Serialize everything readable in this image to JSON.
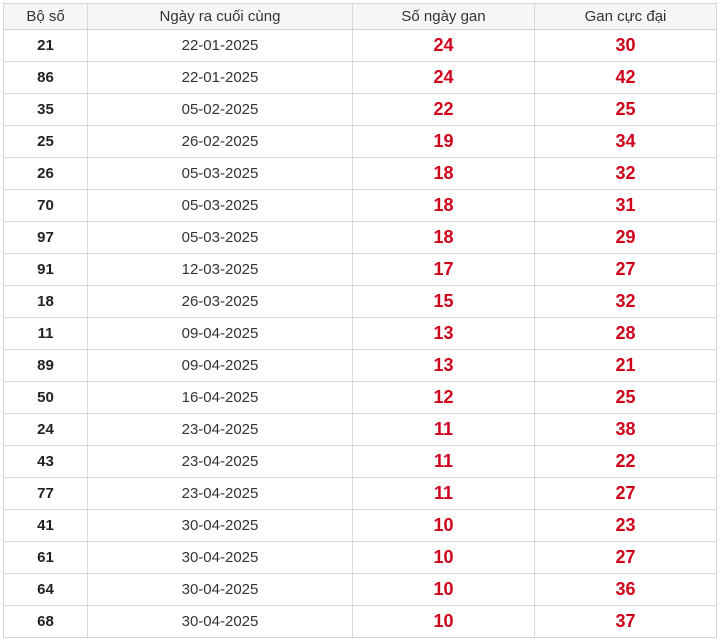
{
  "table": {
    "headers": [
      "Bộ số",
      "Ngày ra cuối cùng",
      "Số ngày gan",
      "Gan cực đại"
    ],
    "rows": [
      {
        "bo_so": "21",
        "ngay": "22-01-2025",
        "so_ngay_gan": "24",
        "gan_cuc_dai": "30"
      },
      {
        "bo_so": "86",
        "ngay": "22-01-2025",
        "so_ngay_gan": "24",
        "gan_cuc_dai": "42"
      },
      {
        "bo_so": "35",
        "ngay": "05-02-2025",
        "so_ngay_gan": "22",
        "gan_cuc_dai": "25"
      },
      {
        "bo_so": "25",
        "ngay": "26-02-2025",
        "so_ngay_gan": "19",
        "gan_cuc_dai": "34"
      },
      {
        "bo_so": "26",
        "ngay": "05-03-2025",
        "so_ngay_gan": "18",
        "gan_cuc_dai": "32"
      },
      {
        "bo_so": "70",
        "ngay": "05-03-2025",
        "so_ngay_gan": "18",
        "gan_cuc_dai": "31"
      },
      {
        "bo_so": "97",
        "ngay": "05-03-2025",
        "so_ngay_gan": "18",
        "gan_cuc_dai": "29"
      },
      {
        "bo_so": "91",
        "ngay": "12-03-2025",
        "so_ngay_gan": "17",
        "gan_cuc_dai": "27"
      },
      {
        "bo_so": "18",
        "ngay": "26-03-2025",
        "so_ngay_gan": "15",
        "gan_cuc_dai": "32"
      },
      {
        "bo_so": "11",
        "ngay": "09-04-2025",
        "so_ngay_gan": "13",
        "gan_cuc_dai": "28"
      },
      {
        "bo_so": "89",
        "ngay": "09-04-2025",
        "so_ngay_gan": "13",
        "gan_cuc_dai": "21"
      },
      {
        "bo_so": "50",
        "ngay": "16-04-2025",
        "so_ngay_gan": "12",
        "gan_cuc_dai": "25"
      },
      {
        "bo_so": "24",
        "ngay": "23-04-2025",
        "so_ngay_gan": "11",
        "gan_cuc_dai": "38"
      },
      {
        "bo_so": "43",
        "ngay": "23-04-2025",
        "so_ngay_gan": "11",
        "gan_cuc_dai": "22"
      },
      {
        "bo_so": "77",
        "ngay": "23-04-2025",
        "so_ngay_gan": "11",
        "gan_cuc_dai": "27"
      },
      {
        "bo_so": "41",
        "ngay": "30-04-2025",
        "so_ngay_gan": "10",
        "gan_cuc_dai": "23"
      },
      {
        "bo_so": "61",
        "ngay": "30-04-2025",
        "so_ngay_gan": "10",
        "gan_cuc_dai": "27"
      },
      {
        "bo_so": "64",
        "ngay": "30-04-2025",
        "so_ngay_gan": "10",
        "gan_cuc_dai": "36"
      },
      {
        "bo_so": "68",
        "ngay": "30-04-2025",
        "so_ngay_gan": "10",
        "gan_cuc_dai": "37"
      }
    ]
  },
  "colors": {
    "header_bg": "#f6f6f6",
    "border": "#d6d6d6",
    "highlight_red": "#d0021b",
    "text_dark": "#222222"
  }
}
